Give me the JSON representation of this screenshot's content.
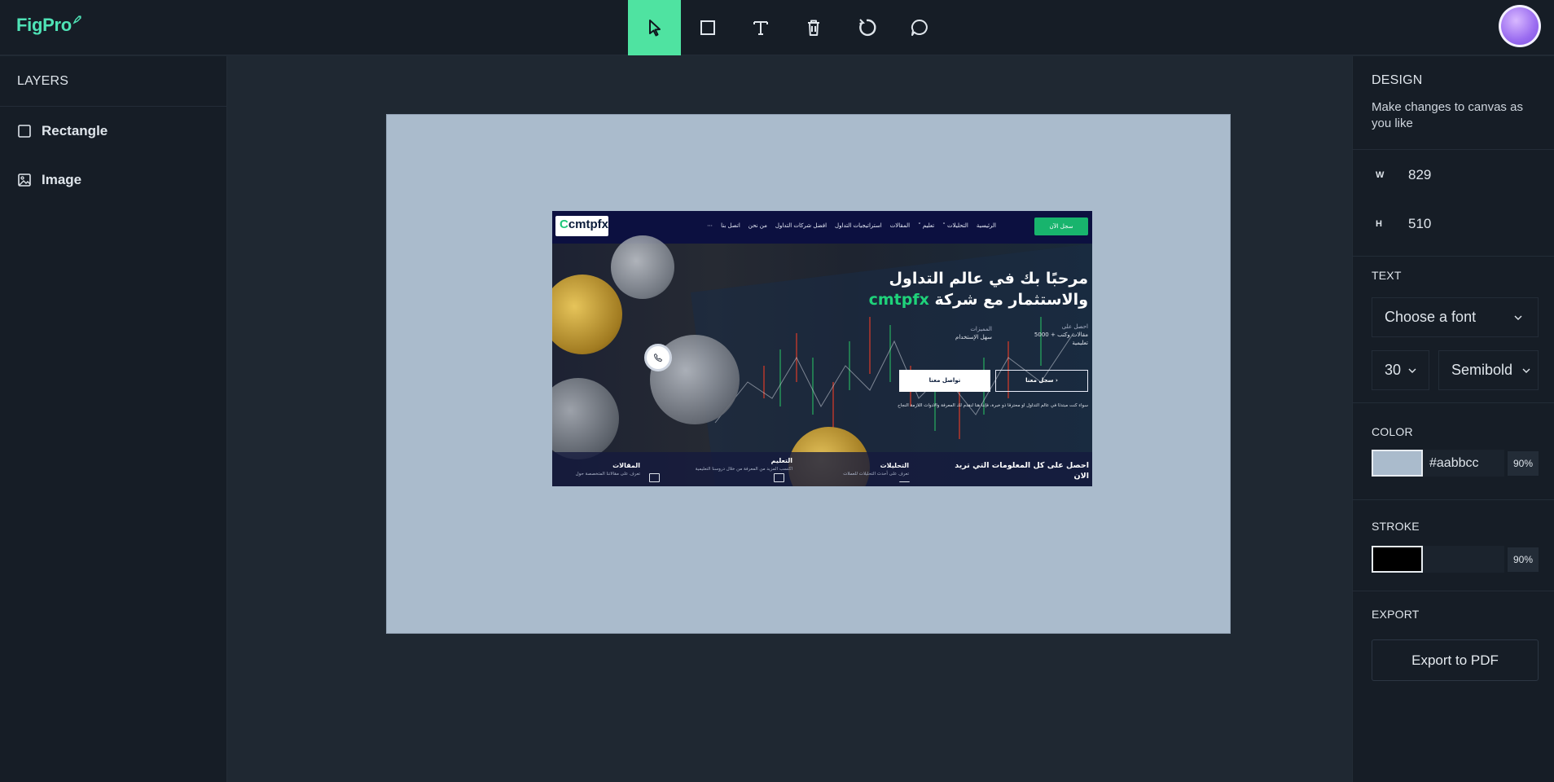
{
  "app": {
    "logo": "FigPro"
  },
  "toolbar": {
    "tools": [
      {
        "name": "select",
        "icon": "cursor-arrow-icon",
        "active": true
      },
      {
        "name": "rectangle",
        "icon": "square-icon"
      },
      {
        "name": "text",
        "icon": "text-t-icon"
      },
      {
        "name": "delete",
        "icon": "trash-icon"
      },
      {
        "name": "reset",
        "icon": "rotate-icon"
      },
      {
        "name": "comment",
        "icon": "chat-bubble-icon"
      }
    ],
    "accent_color": "#4fe3a1"
  },
  "layers": {
    "title": "LAYERS",
    "items": [
      {
        "label": "Rectangle",
        "icon": "square-outline-icon"
      },
      {
        "label": "Image",
        "icon": "image-icon"
      }
    ]
  },
  "canvas": {
    "artboard_color": "#aabbcc",
    "embedded_site": {
      "logo": "cmtpfx",
      "logo_accent": "C",
      "nav_items": [
        "الرئيسية",
        "التحليلات ˅",
        "تعليم ˅",
        "المقالات",
        "استراتيجيات التداول",
        "افضل شركات التداول",
        "من نحن",
        "اتصل بنا",
        "⋯"
      ],
      "nav_cta": "سجل الآن",
      "hero_title_line1": "مرحبًا بك في عالم التداول",
      "hero_title_line2_prefix": "والاستثمار مع شركة ",
      "hero_title_brand": "cmtpfx",
      "stat1_label": "احصل على",
      "stat1_value": "مقالات وكتب + 5000",
      "stat1_value2": "تعليمية",
      "stat2_label": "المميزات",
      "stat2_value": "سهل الإستخدام",
      "btn_register": "سجل معنا ›",
      "btn_contact": "تواصل معنا",
      "hero_sub": "سواء كنت مبتدئًا في عالم التداول أو محترفًا ذو خبرة، فإننا هنا لنقدم لك المعرفة والأدوات اللازمة النجاح",
      "info_cta": "احصل على كل المعلومات التي تريد الان",
      "features": [
        {
          "title": "التحليلات",
          "desc": "تعرف على أحدث التحليلات للعملات"
        },
        {
          "title": "التعليم",
          "desc": "اكتسب المزيد من المعرفة من خلال دروسنا التعليمية"
        },
        {
          "title": "المقالات",
          "desc": "تعرف على مقالاتنا المتخصصة حول"
        }
      ]
    }
  },
  "design": {
    "title": "DESIGN",
    "description": "Make changes to canvas as you like",
    "w_label": "W",
    "w_value": "829",
    "h_label": "H",
    "h_value": "510",
    "text_label": "TEXT",
    "font_placeholder": "Choose a font",
    "font_size": "30",
    "font_weight": "Semibold",
    "color_label": "COLOR",
    "color_hex": "#aabbcc",
    "color_opacity": "90%",
    "stroke_label": "STROKE",
    "stroke_color": "#000000",
    "stroke_opacity": "90%",
    "export_label": "EXPORT",
    "export_button": "Export to PDF"
  }
}
